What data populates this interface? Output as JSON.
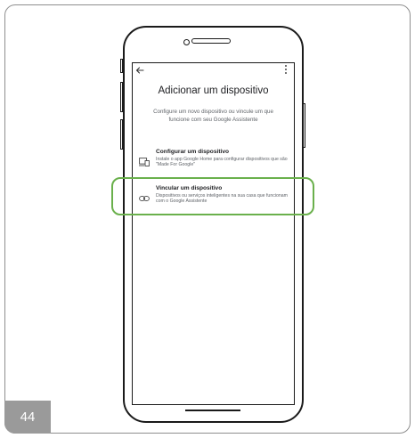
{
  "page": {
    "number": "44"
  },
  "phone": {
    "title": "Adicionar um dispositivo",
    "subtitle": "Configure um novo dispositivo ou vincule um que funcione com seu Google Assistente",
    "options": [
      {
        "label": "Configurar um dispositivo",
        "description": "Instale o app Google Home para configurar dispositivos que são \"Made For Google\"",
        "icon": "device-setup-icon"
      },
      {
        "label": "Vincular um dispositivo",
        "description": "Dispositivos ou serviços inteligentes na sua casa que funcionam com o Google Assistente",
        "icon": "link-icon"
      }
    ],
    "icons": {
      "back": "back-arrow-icon",
      "menu": "more-vert-icon"
    }
  },
  "colors": {
    "highlight": "#6ab04c",
    "page_tab": "#9a9a9a"
  }
}
